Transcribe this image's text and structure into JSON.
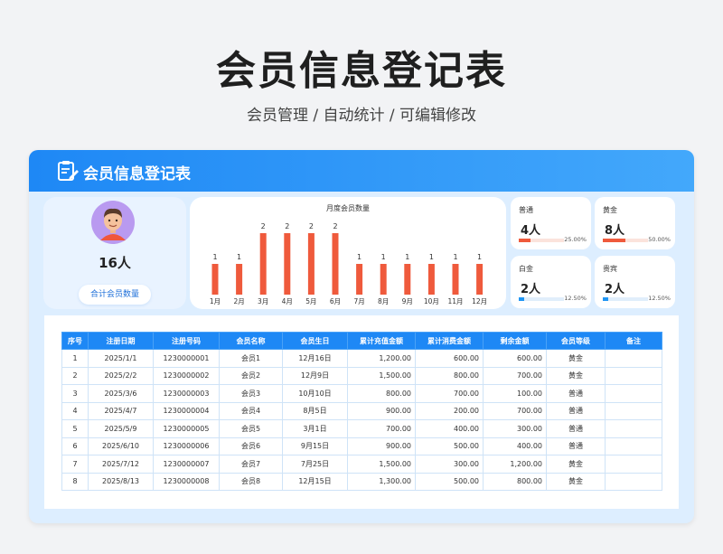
{
  "header": {
    "title": "会员信息登记表",
    "subtitle": "会员管理 / 自动统计 /  可编辑修改"
  },
  "card": {
    "title": "会员信息登记表"
  },
  "summary": {
    "total": "16人",
    "button_label": "合计会员数量"
  },
  "chart_data": {
    "type": "bar",
    "title": "月度会员数量",
    "categories": [
      "1月",
      "2月",
      "3月",
      "4月",
      "5月",
      "6月",
      "7月",
      "8月",
      "9月",
      "10月",
      "11月",
      "12月"
    ],
    "values": [
      1,
      1,
      2,
      2,
      2,
      2,
      1,
      1,
      1,
      1,
      1,
      1
    ],
    "ylim": [
      0,
      2
    ],
    "bar_color": "#ef5a3c",
    "grid": false
  },
  "levels": [
    {
      "name": "普通",
      "count": "4人",
      "percent": "25.00%",
      "ratio": 0.25,
      "color": "#ef5a3c"
    },
    {
      "name": "黄金",
      "count": "8人",
      "percent": "50.00%",
      "ratio": 0.5,
      "color": "#ef5a3c"
    },
    {
      "name": "白金",
      "count": "2人",
      "percent": "12.50%",
      "ratio": 0.125,
      "color": "#2196f3"
    },
    {
      "name": "贵宾",
      "count": "2人",
      "percent": "12.50%",
      "ratio": 0.125,
      "color": "#2196f3"
    }
  ],
  "table": {
    "columns": [
      "序号",
      "注册日期",
      "注册号码",
      "会员名称",
      "会员生日",
      "累计充值金额",
      "累计消费金额",
      "剩余金额",
      "会员等级",
      "备注"
    ],
    "rows": [
      [
        "1",
        "2025/1/1",
        "1230000001",
        "会员1",
        "12月16日",
        "1,200.00",
        "600.00",
        "600.00",
        "黄金",
        ""
      ],
      [
        "2",
        "2025/2/2",
        "1230000002",
        "会员2",
        "12月9日",
        "1,500.00",
        "800.00",
        "700.00",
        "黄金",
        ""
      ],
      [
        "3",
        "2025/3/6",
        "1230000003",
        "会员3",
        "10月10日",
        "800.00",
        "700.00",
        "100.00",
        "普通",
        ""
      ],
      [
        "4",
        "2025/4/7",
        "1230000004",
        "会员4",
        "8月5日",
        "900.00",
        "200.00",
        "700.00",
        "普通",
        ""
      ],
      [
        "5",
        "2025/5/9",
        "1230000005",
        "会员5",
        "3月1日",
        "700.00",
        "400.00",
        "300.00",
        "普通",
        ""
      ],
      [
        "6",
        "2025/6/10",
        "1230000006",
        "会员6",
        "9月15日",
        "900.00",
        "500.00",
        "400.00",
        "普通",
        ""
      ],
      [
        "7",
        "2025/7/12",
        "1230000007",
        "会员7",
        "7月25日",
        "1,500.00",
        "300.00",
        "1,200.00",
        "黄金",
        ""
      ],
      [
        "8",
        "2025/8/13",
        "1230000008",
        "会员8",
        "12月15日",
        "1,300.00",
        "500.00",
        "800.00",
        "黄金",
        ""
      ]
    ]
  }
}
